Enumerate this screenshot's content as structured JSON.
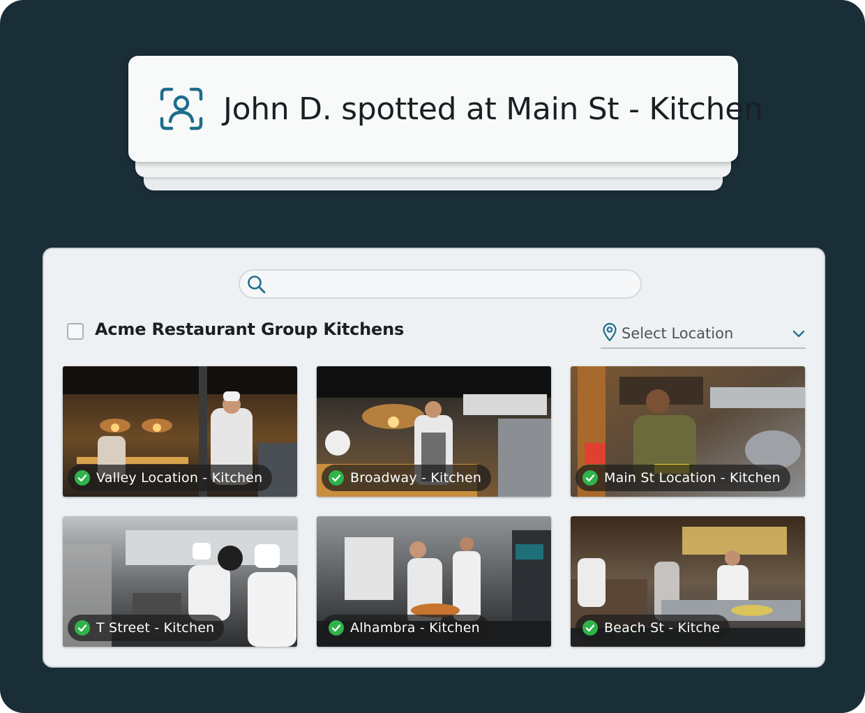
{
  "notification": {
    "icon": "face-scan-icon",
    "message": "John D. spotted at Main St - Kitchen"
  },
  "panel": {
    "search": {
      "value": "",
      "placeholder": ""
    },
    "group_title": "Acme Restaurant Group Kitchens",
    "location_select": {
      "label": "Select Location"
    },
    "cameras": [
      {
        "label": "Valley Location - Kitchen",
        "status": "online"
      },
      {
        "label": "Broadway - Kitchen",
        "status": "online"
      },
      {
        "label": "Main St Location - Kitchen",
        "status": "online"
      },
      {
        "label": "T Street - Kitchen",
        "status": "online"
      },
      {
        "label": "Alhambra - Kitchen",
        "status": "online"
      },
      {
        "label": "Beach St - Kitche",
        "status": "online"
      }
    ]
  },
  "colors": {
    "background": "#1a2e38",
    "accent": "#1e6d8c",
    "status_ok": "#2fb34a"
  }
}
